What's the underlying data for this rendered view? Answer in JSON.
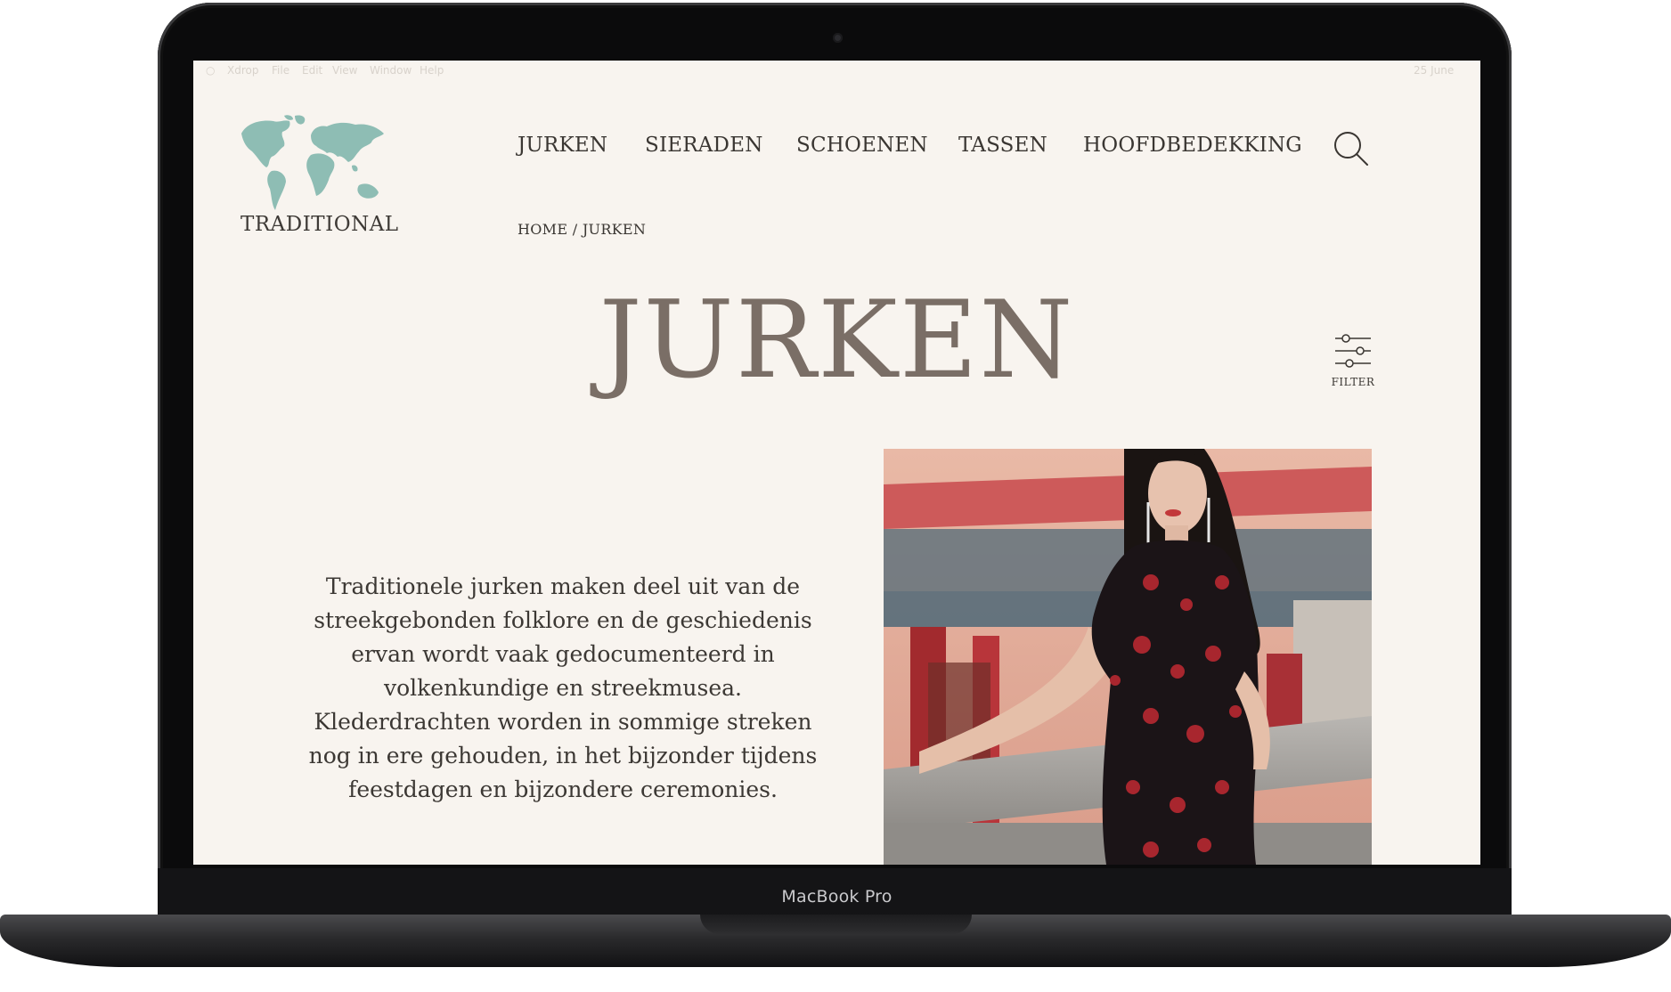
{
  "device": {
    "label": "MacBook Pro"
  },
  "menubar": {
    "items": [
      "Xdrop",
      "File",
      "Edit",
      "View",
      "Window",
      "Help"
    ],
    "right": "25 June"
  },
  "logo": {
    "text": "TRADITIONAL",
    "color": "#8ebdb4"
  },
  "nav": {
    "items": [
      "JURKEN",
      "SIERADEN",
      "SCHOENEN",
      "TASSEN",
      "HOOFDBEDEKKING"
    ]
  },
  "breadcrumb": {
    "home": "HOME",
    "separator": "/",
    "current": "JURKEN"
  },
  "page": {
    "title": "JURKEN"
  },
  "filter": {
    "label": "FILTER"
  },
  "intro": {
    "text": "Traditionele jurken maken deel uit van de streekgebonden folklore en de geschiedenis ervan wordt vaak gedocumenteerd in volkenkundige en streekmusea. Klederdrachten worden in sommige streken nog in ere gehouden, in het bijzonder tijdens feestdagen en bijzondere ceremonies."
  },
  "colors": {
    "background": "#f8f4ef",
    "title": "#7a6e66",
    "text": "#3c3834",
    "accent": "#8ebdb4"
  }
}
